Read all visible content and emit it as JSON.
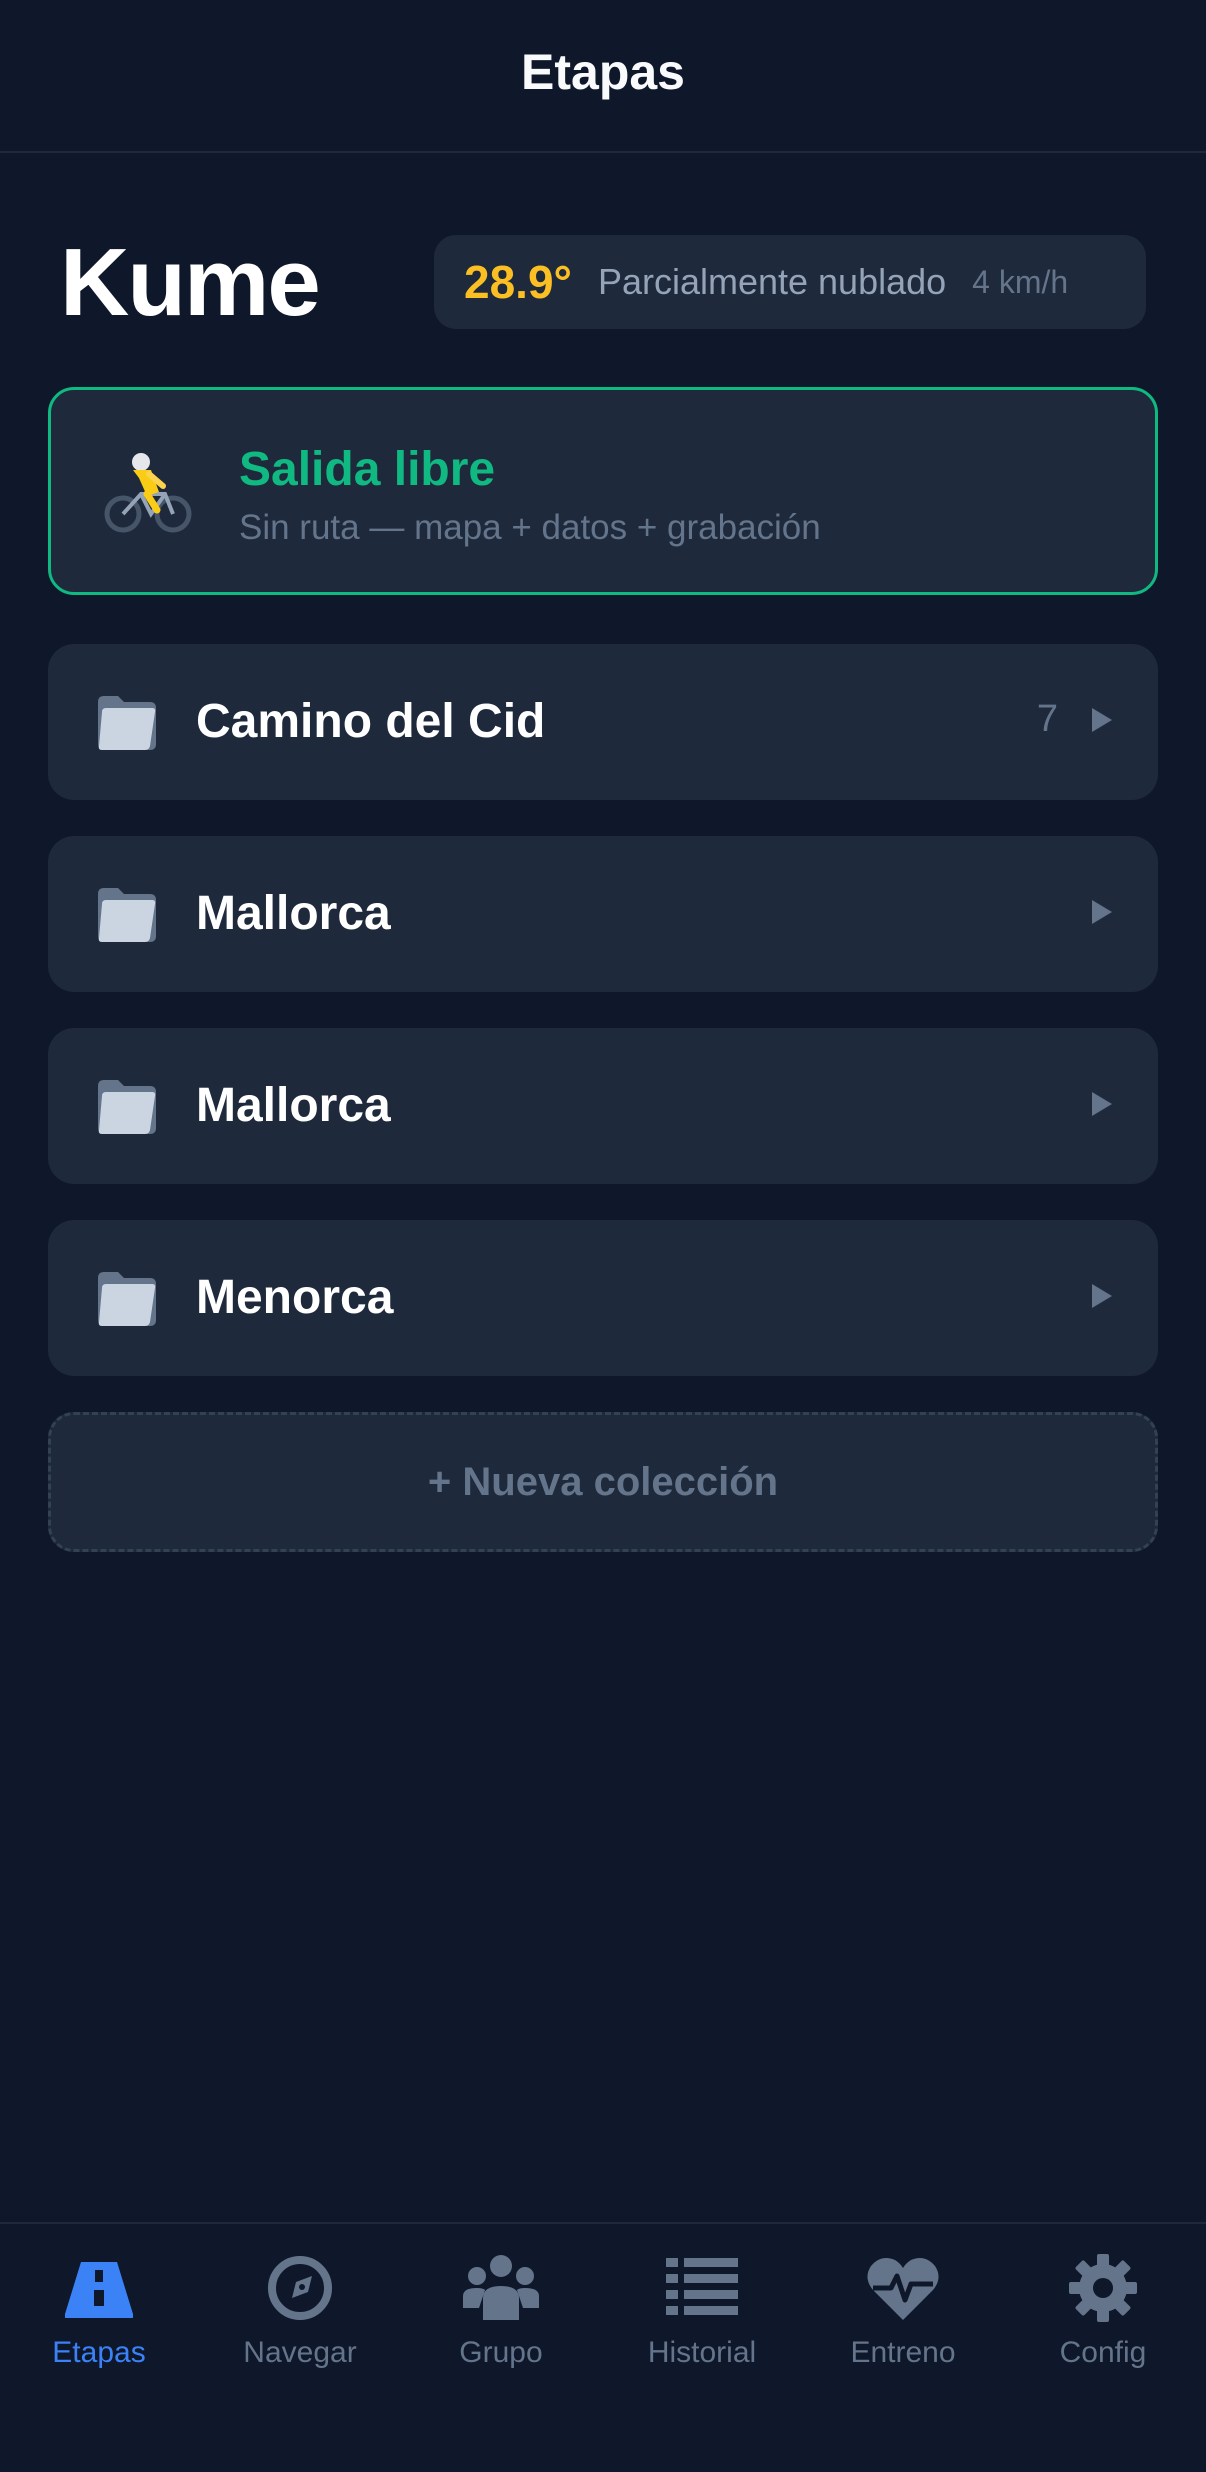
{
  "header": {
    "title": "Etapas"
  },
  "profile": {
    "name": "Kume"
  },
  "weather": {
    "temperature": "28.9°",
    "condition": "Parcialmente nublado",
    "wind": "4 km/h"
  },
  "free_ride": {
    "icon": "cyclist-icon",
    "title": "Salida libre",
    "subtitle": "Sin ruta — mapa + datos + grabación"
  },
  "collections": [
    {
      "name": "Camino del Cid",
      "count": "7",
      "icon": "folder-icon"
    },
    {
      "name": "Mallorca",
      "count": "",
      "icon": "folder-icon"
    },
    {
      "name": "Mallorca",
      "count": "",
      "icon": "folder-icon"
    },
    {
      "name": "Menorca",
      "count": "",
      "icon": "folder-icon"
    }
  ],
  "new_collection": {
    "label": "+ Nueva colección"
  },
  "tabs": [
    {
      "label": "Etapas",
      "icon": "road-icon",
      "active": true
    },
    {
      "label": "Navegar",
      "icon": "compass-icon",
      "active": false
    },
    {
      "label": "Grupo",
      "icon": "group-icon",
      "active": false
    },
    {
      "label": "Historial",
      "icon": "list-icon",
      "active": false
    },
    {
      "label": "Entreno",
      "icon": "heart-pulse-icon",
      "active": false
    },
    {
      "label": "Config",
      "icon": "gear-icon",
      "active": false
    }
  ],
  "colors": {
    "background": "#0f172a",
    "card": "#1e293b",
    "accent_green": "#10b981",
    "accent_blue": "#3b82f6",
    "temperature": "#fbbf24",
    "muted": "#64748b"
  }
}
